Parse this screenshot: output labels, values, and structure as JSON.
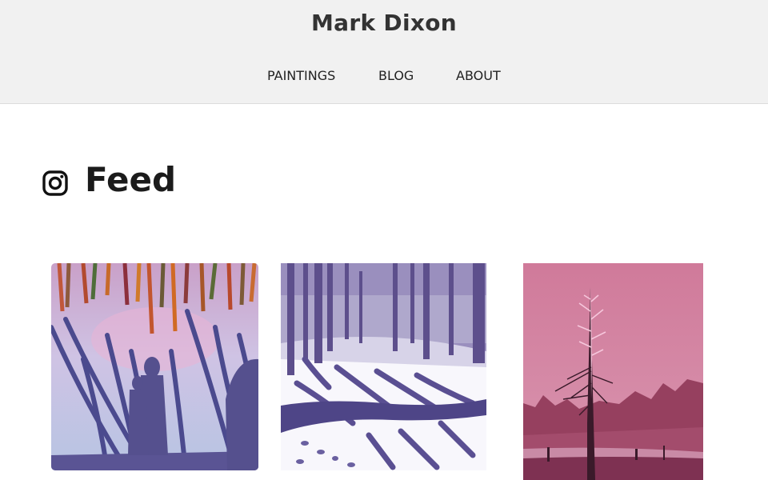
{
  "site": {
    "title": "Mark Dixon"
  },
  "nav": {
    "items": [
      "PAINTINGS",
      "BLOG",
      "ABOUT"
    ]
  },
  "feed": {
    "title": "Feed",
    "icon": "instagram-icon"
  },
  "gallery": {
    "images": [
      {
        "name": "winter-woods-figures-painting"
      },
      {
        "name": "snow-forest-fallen-tree-painting"
      },
      {
        "name": "pink-dead-tree-painting"
      }
    ]
  },
  "colors": {
    "header_bg": "#f1f1f1",
    "text": "#222222",
    "purple": "#5a5190",
    "pink": "#c96f95"
  }
}
